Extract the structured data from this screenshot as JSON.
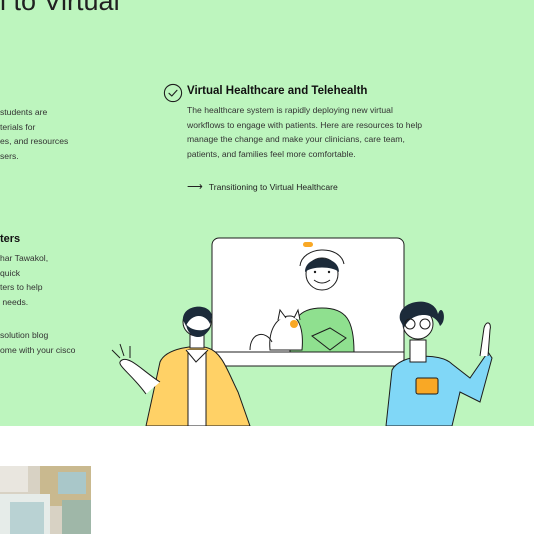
{
  "hero": {
    "headline": "l to Virtual"
  },
  "left_column": {
    "intro_lines": "students are\nterials for\nes, and resources\nsers.",
    "section_heading": "ters",
    "section_lines": "har Tawakol,\nquick\nters to help\n needs.",
    "links_lines": "solution blog\nome with your cisco"
  },
  "virtual_healthcare": {
    "icon": "check-circle-icon",
    "title": "Virtual Healthcare and Telehealth",
    "description": "The healthcare system is rapidly deploying new virtual\nworkflows to engage with patients. Here are resources to help\nmanage the change and make your clinicians, care team,\npatients, and families feel more comfortable.",
    "link_icon": "arrow-right-icon",
    "link_label": "Transitioning to Virtual Healthcare"
  },
  "colors": {
    "background_green": "#bdf5be",
    "screen": "#ffffff",
    "accent_orange": "#f9a825",
    "blue_shirt": "#80d7f7",
    "yellow_shirt": "#ffd166",
    "green_shirt": "#8fe08f"
  },
  "illustration": {
    "name": "video-call-illustration"
  }
}
